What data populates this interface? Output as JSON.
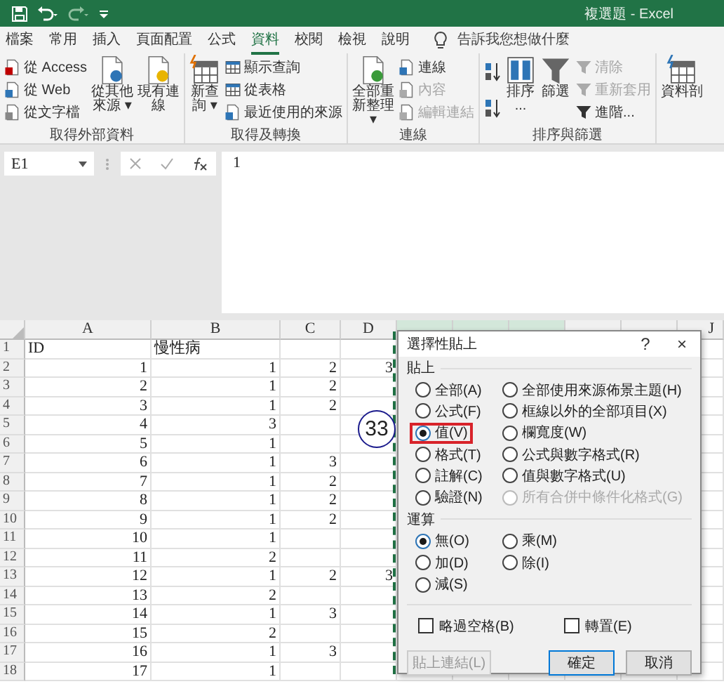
{
  "window": {
    "title": "複選題 - Excel"
  },
  "menu_tabs": [
    {
      "label": "檔案",
      "selected": false
    },
    {
      "label": "常用",
      "selected": false
    },
    {
      "label": "插入",
      "selected": false
    },
    {
      "label": "頁面配置",
      "selected": false
    },
    {
      "label": "公式",
      "selected": false
    },
    {
      "label": "資料",
      "selected": true
    },
    {
      "label": "校閱",
      "selected": false
    },
    {
      "label": "檢視",
      "selected": false
    },
    {
      "label": "說明",
      "selected": false
    }
  ],
  "tell_me": {
    "placeholder": "告訴我您想做什麼"
  },
  "ribbon": [
    {
      "label": "取得外部資料",
      "columns": [
        {
          "kind": "small",
          "buttons": [
            {
              "label": "從 Access",
              "disabled": false
            },
            {
              "label": "從 Web",
              "disabled": false
            },
            {
              "label": "從文字檔",
              "disabled": false
            }
          ]
        },
        {
          "kind": "large",
          "lines": [
            "從其他",
            "來源 ▾"
          ]
        },
        {
          "kind": "large",
          "lines": [
            "現有連線"
          ]
        }
      ]
    },
    {
      "label": "取得及轉換",
      "columns": [
        {
          "kind": "large",
          "lines": [
            "新查",
            "詢 ▾"
          ]
        },
        {
          "kind": "small",
          "buttons": [
            {
              "label": "顯示查詢",
              "disabled": false
            },
            {
              "label": "從表格",
              "disabled": false
            },
            {
              "label": "最近使用的來源",
              "disabled": false
            }
          ]
        }
      ]
    },
    {
      "label": "連線",
      "columns": [
        {
          "kind": "large",
          "lines": [
            "全部重新整理",
            "▾"
          ]
        },
        {
          "kind": "small",
          "buttons": [
            {
              "label": "連線",
              "disabled": false
            },
            {
              "label": "內容",
              "disabled": true
            },
            {
              "label": "編輯連結",
              "disabled": true
            }
          ]
        }
      ]
    },
    {
      "label": "排序與篩選",
      "columns": [
        {
          "kind": "sort-pair"
        },
        {
          "kind": "large",
          "lines": [
            "排序",
            "..."
          ]
        },
        {
          "kind": "large",
          "lines": [
            "篩選"
          ]
        },
        {
          "kind": "small",
          "buttons": [
            {
              "label": "清除",
              "disabled": true
            },
            {
              "label": "重新套用",
              "disabled": true
            },
            {
              "label": "進階...",
              "disabled": false
            }
          ]
        }
      ]
    },
    {
      "columns": [
        {
          "kind": "large",
          "lines": [
            "資料剖"
          ]
        }
      ]
    }
  ],
  "name_box": {
    "value": "E1"
  },
  "formula_bar": {
    "value": "1"
  },
  "sheet": {
    "columns": [
      {
        "label": "A",
        "selected": false
      },
      {
        "label": "B",
        "selected": false
      },
      {
        "label": "C",
        "selected": false
      },
      {
        "label": "D",
        "selected": false
      },
      {
        "selected": true
      },
      {
        "selected": true
      },
      {
        "selected": true
      },
      {
        "selected": false
      },
      {
        "selected": false
      },
      {
        "label": "J",
        "selected": false
      }
    ],
    "rows": [
      {
        "header": "1",
        "kind": "text",
        "cells": [
          "ID",
          "慢性病"
        ]
      },
      {
        "header": "2",
        "kind": "number",
        "cells": [
          "1",
          "1",
          "2",
          "3"
        ]
      },
      {
        "header": "3",
        "kind": "number",
        "cells": [
          "2",
          "1",
          "2"
        ]
      },
      {
        "header": "4",
        "kind": "number",
        "cells": [
          "3",
          "1",
          "2"
        ]
      },
      {
        "header": "5",
        "kind": "number",
        "cells": [
          "4",
          "3"
        ]
      },
      {
        "header": "6",
        "kind": "number",
        "cells": [
          "5",
          "1"
        ]
      },
      {
        "header": "7",
        "kind": "number",
        "cells": [
          "6",
          "1",
          "3"
        ]
      },
      {
        "header": "8",
        "kind": "number",
        "cells": [
          "7",
          "1",
          "2"
        ]
      },
      {
        "header": "9",
        "kind": "number",
        "cells": [
          "8",
          "1",
          "2"
        ]
      },
      {
        "header": "10",
        "kind": "number",
        "cells": [
          "9",
          "1",
          "2"
        ]
      },
      {
        "header": "11",
        "kind": "number",
        "cells": [
          "10",
          "1"
        ]
      },
      {
        "header": "12",
        "kind": "number",
        "cells": [
          "11",
          "2"
        ]
      },
      {
        "header": "13",
        "kind": "number",
        "cells": [
          "12",
          "1",
          "2",
          "3"
        ]
      },
      {
        "header": "14",
        "kind": "number",
        "cells": [
          "13",
          "2"
        ]
      },
      {
        "header": "15",
        "kind": "number",
        "cells": [
          "14",
          "1",
          "3"
        ]
      },
      {
        "header": "16",
        "kind": "number",
        "cells": [
          "15",
          "2"
        ]
      },
      {
        "header": "17",
        "kind": "number",
        "cells": [
          "16",
          "1",
          "3"
        ]
      },
      {
        "header": "18",
        "kind": "number",
        "cells": [
          "17",
          "1"
        ]
      }
    ]
  },
  "annotation": {
    "label": "33"
  },
  "dialog": {
    "title": "選擇性貼上",
    "help": "?",
    "close": "×",
    "sections": [
      {
        "label": "貼上",
        "columns": [
          [
            {
              "label": "全部(A)",
              "selected": false,
              "disabled": false,
              "highlighted": false
            },
            {
              "label": "公式(F)",
              "selected": false,
              "disabled": false,
              "highlighted": false
            },
            {
              "label": "值(V)",
              "selected": true,
              "disabled": false,
              "highlighted": true
            },
            {
              "label": "格式(T)",
              "selected": false,
              "disabled": false,
              "highlighted": false
            },
            {
              "label": "註解(C)",
              "selected": false,
              "disabled": false,
              "highlighted": false
            },
            {
              "label": "驗證(N)",
              "selected": false,
              "disabled": false,
              "highlighted": false
            }
          ],
          [
            {
              "label": "全部使用來源佈景主題(H)",
              "selected": false,
              "disabled": false,
              "highlighted": false
            },
            {
              "label": "框線以外的全部項目(X)",
              "selected": false,
              "disabled": false,
              "highlighted": false
            },
            {
              "label": "欄寬度(W)",
              "selected": false,
              "disabled": false,
              "highlighted": false
            },
            {
              "label": "公式與數字格式(R)",
              "selected": false,
              "disabled": false,
              "highlighted": false
            },
            {
              "label": "值與數字格式(U)",
              "selected": false,
              "disabled": false,
              "highlighted": false
            },
            {
              "label": "所有合併中條件化格式(G)",
              "selected": false,
              "disabled": true,
              "highlighted": false
            }
          ]
        ]
      },
      {
        "label": "運算",
        "columns": [
          [
            {
              "label": "無(O)",
              "selected": true,
              "disabled": false,
              "highlighted": false
            },
            {
              "label": "加(D)",
              "selected": false,
              "disabled": false,
              "highlighted": false
            },
            {
              "label": "減(S)",
              "selected": false,
              "disabled": false,
              "highlighted": false
            }
          ],
          [
            {
              "label": "乘(M)",
              "selected": false,
              "disabled": false,
              "highlighted": false
            },
            {
              "label": "除(I)",
              "selected": false,
              "disabled": false,
              "highlighted": false
            }
          ]
        ]
      }
    ],
    "checkboxes": [
      {
        "label": "略過空格(B)",
        "checked": false
      },
      {
        "label": "轉置(E)",
        "checked": false
      }
    ],
    "buttons": [
      {
        "label": "貼上連結(L)",
        "disabled": true,
        "default": false
      },
      {
        "label": "確定",
        "disabled": false,
        "default": true
      },
      {
        "label": "取消",
        "disabled": false,
        "default": false
      }
    ]
  }
}
